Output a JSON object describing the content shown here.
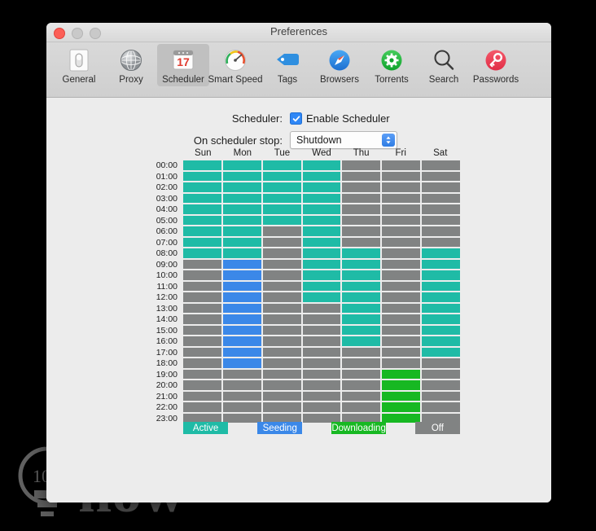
{
  "window": {
    "title": "Preferences",
    "traffic_lights": [
      "close",
      "minimize",
      "zoom"
    ]
  },
  "toolbar": {
    "items": [
      {
        "label": "General",
        "icon": "general-switch-icon",
        "selected": false
      },
      {
        "label": "Proxy",
        "icon": "globe-icon",
        "selected": false
      },
      {
        "label": "Scheduler",
        "icon": "calendar-17-icon",
        "selected": true
      },
      {
        "label": "Smart Speed",
        "icon": "speedometer-icon",
        "selected": false
      },
      {
        "label": "Tags",
        "icon": "tag-icon",
        "selected": false
      },
      {
        "label": "Browsers",
        "icon": "compass-icon",
        "selected": false
      },
      {
        "label": "Torrents",
        "icon": "gear-circle-icon",
        "selected": false
      },
      {
        "label": "Search",
        "icon": "magnifier-icon",
        "selected": false
      },
      {
        "label": "Passwords",
        "icon": "key-circle-icon",
        "selected": false
      }
    ],
    "calendar_day": "17"
  },
  "form": {
    "scheduler_label": "Scheduler:",
    "enable_checkbox_label": "Enable Scheduler",
    "enable_checked": true,
    "on_stop_label": "On scheduler stop:",
    "on_stop_value": "Shutdown",
    "on_stop_options": [
      "Shutdown"
    ]
  },
  "colors": {
    "active": "#1fbba6",
    "seeding": "#3b88e8",
    "downloading": "#17b822",
    "off": "#818383",
    "window_bg": "#ececec",
    "accent_blue": "#2f87f6"
  },
  "legend": [
    {
      "label": "Active",
      "state": "active"
    },
    {
      "label": "Seeding",
      "state": "seeding"
    },
    {
      "label": "Downloading",
      "state": "downloading"
    },
    {
      "label": "Off",
      "state": "off"
    }
  ],
  "schedule": {
    "days": [
      "Sun",
      "Mon",
      "Tue",
      "Wed",
      "Thu",
      "Fri",
      "Sat"
    ],
    "hours": [
      "00:00",
      "01:00",
      "02:00",
      "03:00",
      "04:00",
      "05:00",
      "06:00",
      "07:00",
      "08:00",
      "09:00",
      "10:00",
      "11:00",
      "12:00",
      "13:00",
      "14:00",
      "15:00",
      "16:00",
      "17:00",
      "18:00",
      "19:00",
      "20:00",
      "21:00",
      "22:00",
      "23:00"
    ],
    "legend_states": [
      "active",
      "seeding",
      "downloading",
      "off"
    ],
    "grid": [
      [
        "active",
        "active",
        "active",
        "active",
        "off",
        "off",
        "off"
      ],
      [
        "active",
        "active",
        "active",
        "active",
        "off",
        "off",
        "off"
      ],
      [
        "active",
        "active",
        "active",
        "active",
        "off",
        "off",
        "off"
      ],
      [
        "active",
        "active",
        "active",
        "active",
        "off",
        "off",
        "off"
      ],
      [
        "active",
        "active",
        "active",
        "active",
        "off",
        "off",
        "off"
      ],
      [
        "active",
        "active",
        "active",
        "active",
        "off",
        "off",
        "off"
      ],
      [
        "active",
        "active",
        "off",
        "active",
        "off",
        "off",
        "off"
      ],
      [
        "active",
        "active",
        "off",
        "active",
        "off",
        "off",
        "off"
      ],
      [
        "active",
        "active",
        "off",
        "active",
        "active",
        "off",
        "active"
      ],
      [
        "off",
        "seeding",
        "off",
        "active",
        "active",
        "off",
        "active"
      ],
      [
        "off",
        "seeding",
        "off",
        "active",
        "active",
        "off",
        "active"
      ],
      [
        "off",
        "seeding",
        "off",
        "active",
        "active",
        "off",
        "active"
      ],
      [
        "off",
        "seeding",
        "off",
        "active",
        "active",
        "off",
        "active"
      ],
      [
        "off",
        "seeding",
        "off",
        "off",
        "active",
        "off",
        "active"
      ],
      [
        "off",
        "seeding",
        "off",
        "off",
        "active",
        "off",
        "active"
      ],
      [
        "off",
        "seeding",
        "off",
        "off",
        "active",
        "off",
        "active"
      ],
      [
        "off",
        "seeding",
        "off",
        "off",
        "active",
        "off",
        "active"
      ],
      [
        "off",
        "seeding",
        "off",
        "off",
        "off",
        "off",
        "active"
      ],
      [
        "off",
        "seeding",
        "off",
        "off",
        "off",
        "off",
        "off"
      ],
      [
        "off",
        "off",
        "off",
        "off",
        "off",
        "downloading",
        "off"
      ],
      [
        "off",
        "off",
        "off",
        "off",
        "off",
        "downloading",
        "off"
      ],
      [
        "off",
        "off",
        "off",
        "off",
        "off",
        "downloading",
        "off"
      ],
      [
        "off",
        "off",
        "off",
        "off",
        "off",
        "downloading",
        "off"
      ],
      [
        "off",
        "off",
        "off",
        "off",
        "off",
        "downloading",
        "off"
      ]
    ]
  },
  "watermark": {
    "text": "how"
  }
}
